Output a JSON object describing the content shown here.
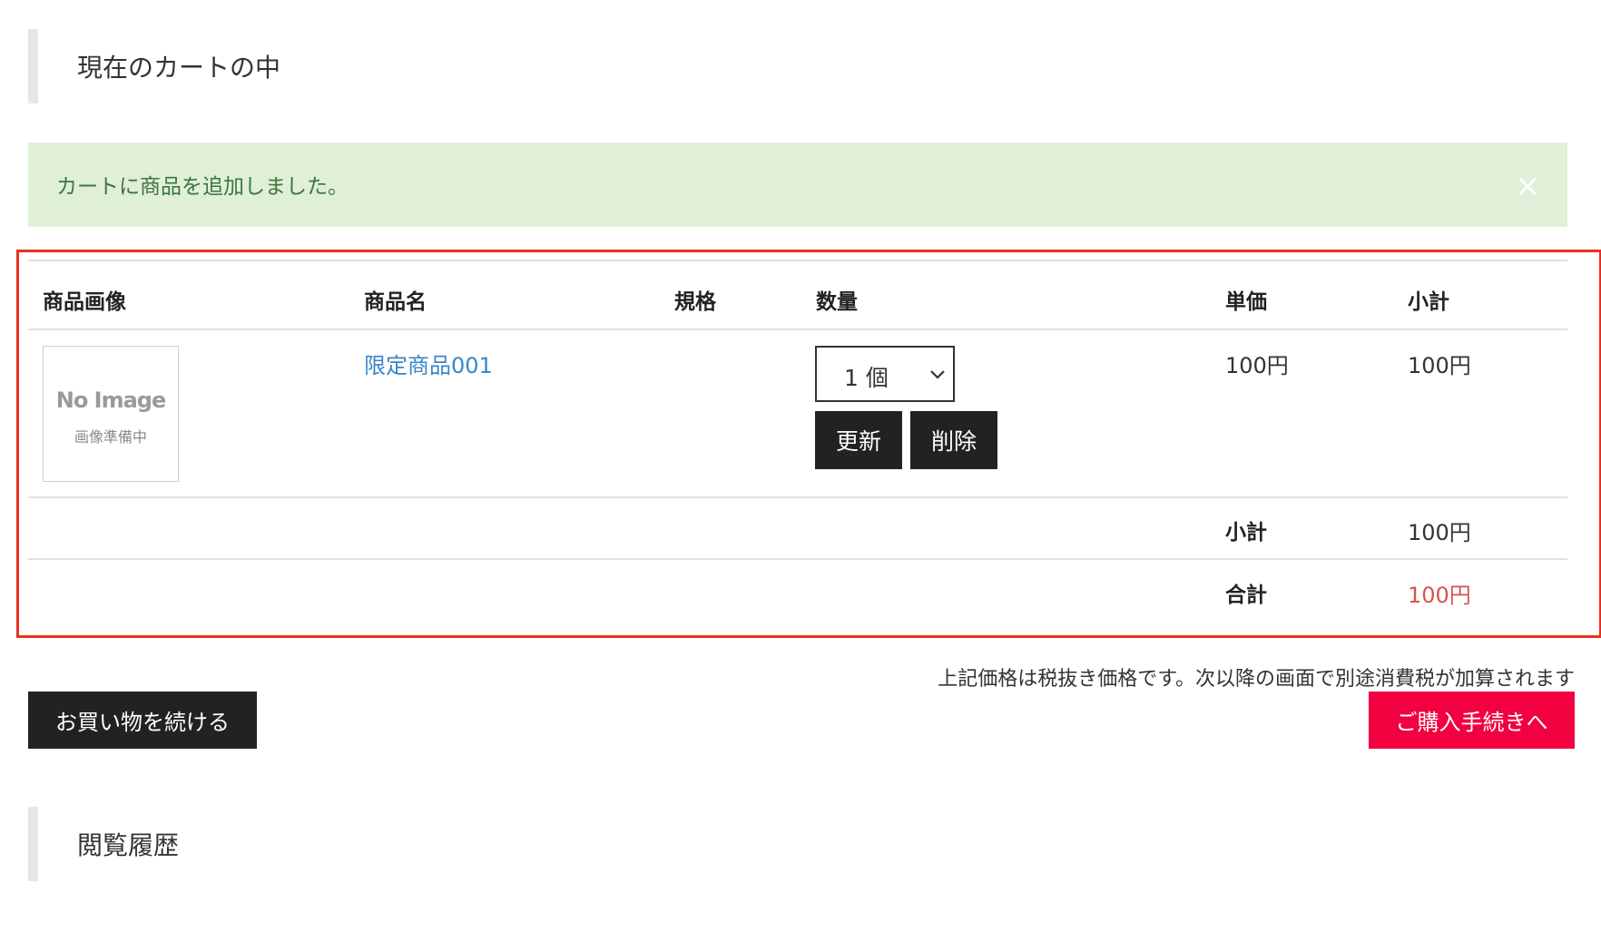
{
  "cart": {
    "heading": "現在のカートの中"
  },
  "alert": {
    "message": "カートに商品を追加しました。",
    "close_label": "×"
  },
  "table": {
    "headers": {
      "image": "商品画像",
      "name": "商品名",
      "spec": "規格",
      "quantity": "数量",
      "unit_price": "単価",
      "subtotal": "小計"
    },
    "items": [
      {
        "image_placeholder_title": "No Image",
        "image_placeholder_sub": "画像準備中",
        "name": "限定商品001",
        "spec": "",
        "quantity": "1 個",
        "update_label": "更新",
        "delete_label": "削除",
        "unit_price": "100円",
        "subtotal": "100円"
      }
    ],
    "summary": {
      "subtotal_label": "小計",
      "subtotal_value": "100円",
      "total_label": "合計",
      "total_value": "100円"
    }
  },
  "footer": {
    "tax_note": "上記価格は税抜き価格です。次以降の画面で別途消費税が加算されます",
    "continue_label": "お買い物を続ける",
    "checkout_label": "ご購入手続きへ"
  },
  "history": {
    "heading": "閲覧履歴"
  },
  "colors": {
    "alert_bg": "#e0efd8",
    "alert_text": "#3c763d",
    "highlight_frame": "#e8301f",
    "checkout_bg": "#f1013f",
    "total_value": "#d9534f",
    "link": "#3a86c5"
  }
}
